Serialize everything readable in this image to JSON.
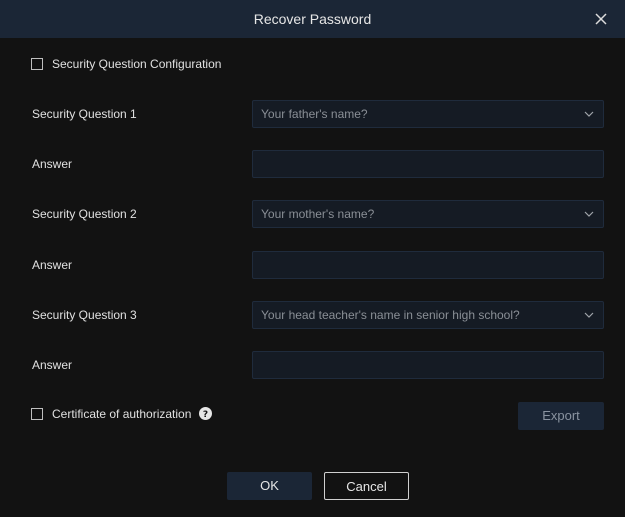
{
  "dialog": {
    "title": "Recover Password",
    "close_icon": "close-icon"
  },
  "security_config": {
    "label": "Security Question Configuration",
    "checked": false
  },
  "questions": [
    {
      "label": "Security Question 1",
      "selected": "Your father's name?",
      "answer_label": "Answer",
      "answer_value": ""
    },
    {
      "label": "Security Question 2",
      "selected": "Your mother's name?",
      "answer_label": "Answer",
      "answer_value": ""
    },
    {
      "label": "Security Question 3",
      "selected": "Your head teacher's name in senior high school?",
      "answer_label": "Answer",
      "answer_value": ""
    }
  ],
  "certificate": {
    "label": "Certificate of authorization",
    "checked": false,
    "help_icon": "help-circle-icon",
    "export_label": "Export"
  },
  "footer": {
    "ok_label": "OK",
    "cancel_label": "Cancel"
  },
  "colors": {
    "background": "#121212",
    "titlebar": "#1b2636",
    "field": "#151b24",
    "text": "#e0e0e0",
    "muted_text": "#8a8f96"
  }
}
